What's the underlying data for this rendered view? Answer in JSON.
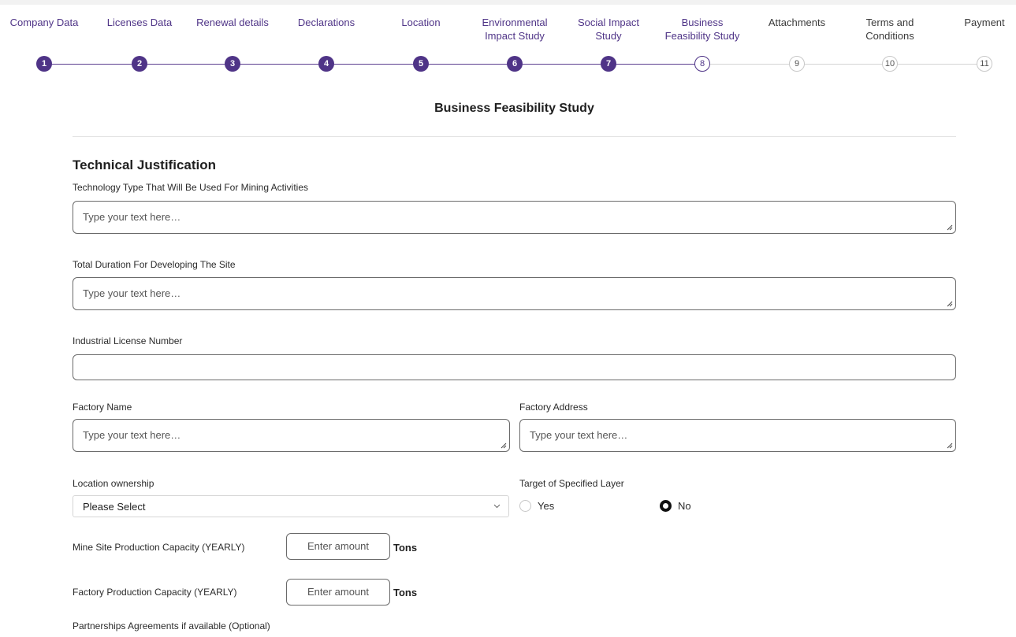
{
  "stepper": {
    "steps": [
      {
        "label": "Company Data",
        "number": "1",
        "state": "done"
      },
      {
        "label": "Licenses Data",
        "number": "2",
        "state": "done"
      },
      {
        "label": "Renewal details",
        "number": "3",
        "state": "done"
      },
      {
        "label": "Declarations",
        "number": "4",
        "state": "done"
      },
      {
        "label": "Location",
        "number": "5",
        "state": "done"
      },
      {
        "label": "Environmental Impact Study",
        "number": "6",
        "state": "done"
      },
      {
        "label": "Social Impact Study",
        "number": "7",
        "state": "done"
      },
      {
        "label": "Business Feasibility Study",
        "number": "8",
        "state": "current"
      },
      {
        "label": "Attachments",
        "number": "9",
        "state": "pending"
      },
      {
        "label": "Terms and Conditions",
        "number": "10",
        "state": "pending"
      },
      {
        "label": "Payment",
        "number": "11",
        "state": "pending"
      }
    ]
  },
  "page": {
    "title": "Business Feasibility Study"
  },
  "section": {
    "title": "Technical Justification"
  },
  "fields": {
    "technology_type": {
      "label": "Technology Type That Will Be Used For Mining Activities",
      "placeholder": "Type your text here…"
    },
    "total_duration": {
      "label": "Total Duration For Developing The Site",
      "placeholder": "Type your text here…"
    },
    "industrial_license": {
      "label": "Industrial License Number",
      "value": ""
    },
    "factory_name": {
      "label": "Factory Name",
      "placeholder": "Type your text here…"
    },
    "factory_address": {
      "label": "Factory Address",
      "placeholder": "Type your text here…"
    },
    "location_ownership": {
      "label": "Location ownership",
      "value": "Please Select"
    },
    "target_layer": {
      "label": "Target of Specified Layer",
      "options": [
        "Yes",
        "No"
      ],
      "selected": "No"
    },
    "mine_capacity": {
      "label": "Mine Site Production Capacity (YEARLY)",
      "placeholder": "Enter amount",
      "unit": "Tons"
    },
    "factory_capacity": {
      "label": "Factory Production Capacity (YEARLY)",
      "placeholder": "Enter amount",
      "unit": "Tons"
    },
    "partnerships": {
      "label": "Partnerships Agreements if available (Optional)"
    }
  },
  "colors": {
    "accent": "#4f3487",
    "pending": "#c8c8c8"
  }
}
